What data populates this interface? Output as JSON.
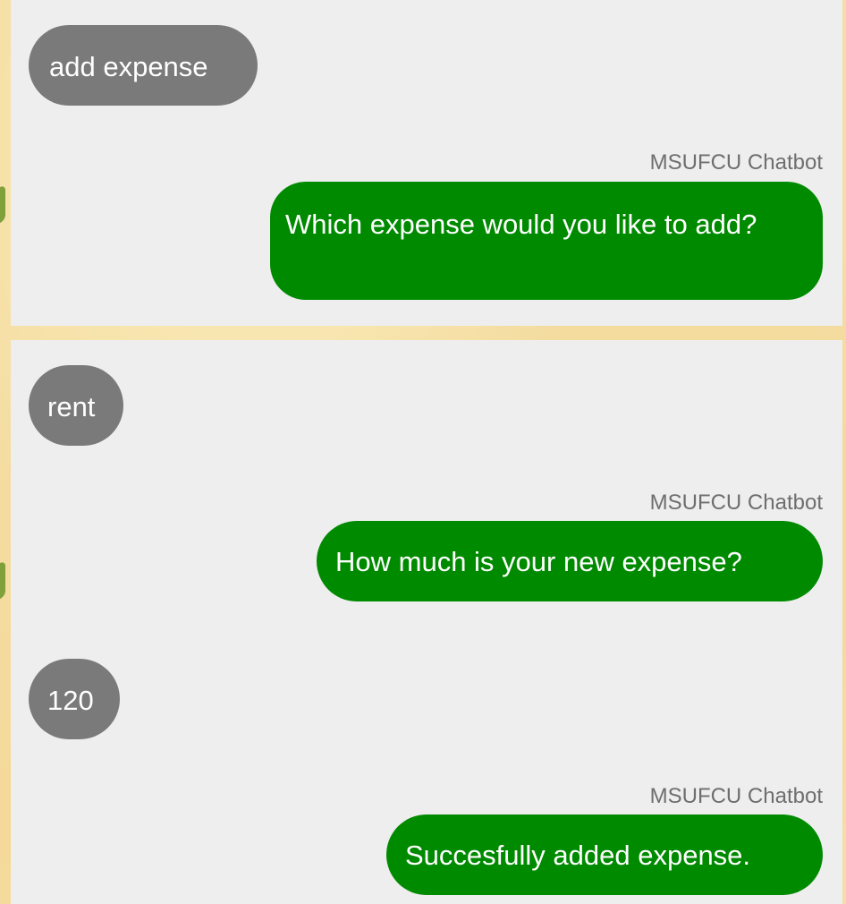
{
  "messages": [
    {
      "sender": "user",
      "text": "add expense"
    },
    {
      "sender": "bot",
      "sender_name": "MSUFCU Chatbot",
      "text": "Which expense would you like to add?"
    },
    {
      "sender": "user",
      "text": "rent"
    },
    {
      "sender": "bot",
      "sender_name": "MSUFCU Chatbot",
      "text": "How much is your new expense?"
    },
    {
      "sender": "user",
      "text": "120"
    },
    {
      "sender": "bot",
      "sender_name": "MSUFCU Chatbot",
      "text": "Succesfully added expense."
    }
  ],
  "colors": {
    "user_bubble": "#7a7a7a",
    "bot_bubble": "#008a00",
    "panel_background": "#eeeeee",
    "page_background": "#f5dea4",
    "sender_label": "#6e6e6e"
  }
}
